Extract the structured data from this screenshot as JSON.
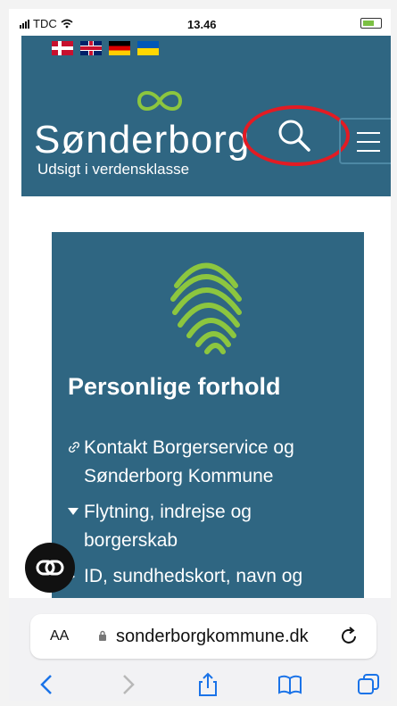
{
  "status": {
    "carrier": "TDC",
    "time": "13.46"
  },
  "header": {
    "brand_name": "Sønderborg",
    "brand_tagline": "Udsigt i verdensklasse",
    "brand_color": "#2f6682",
    "accent_color": "#8cc63f",
    "flags": [
      "Danish",
      "English",
      "German",
      "Ukrainian"
    ]
  },
  "card": {
    "title": "Personlige forhold",
    "items": [
      {
        "marker": "link-icon",
        "label": "Kontakt Borgerservice og Sønderborg Kommune"
      },
      {
        "marker": "triangle-down-icon",
        "label": "Flytning, indrejse og borgerskab"
      },
      {
        "marker": "triangle-right-icon",
        "label": "ID, sundhedskort, navn og attester"
      }
    ]
  },
  "browser": {
    "aa_label": "AA",
    "url": "sonderborgkommune.dk"
  },
  "highlight_color": "#e31b23"
}
